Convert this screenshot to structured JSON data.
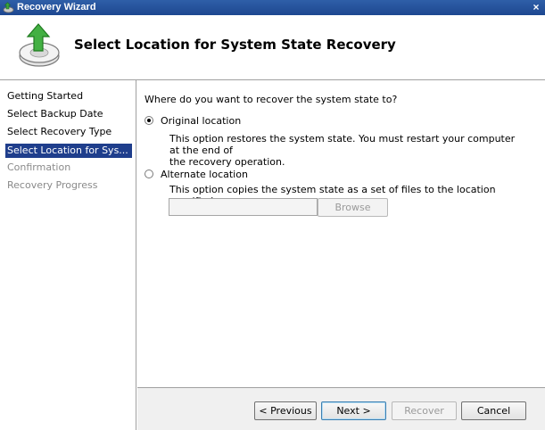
{
  "window": {
    "title": "Recovery Wizard",
    "close_glyph": "×"
  },
  "header": {
    "title": "Select Location for System State Recovery",
    "icon": "recovery-wizard-icon"
  },
  "steps": [
    {
      "label": "Getting Started",
      "state": "done"
    },
    {
      "label": "Select Backup Date",
      "state": "done"
    },
    {
      "label": "Select Recovery Type",
      "state": "done"
    },
    {
      "label": "Select Location for Sys...",
      "state": "active"
    },
    {
      "label": "Confirmation",
      "state": "future"
    },
    {
      "label": "Recovery Progress",
      "state": "future"
    }
  ],
  "content": {
    "question": "Where do you want to recover the system state to?",
    "original": {
      "label": "Original location",
      "checked": true,
      "desc_line1": "This option restores the system state. You must restart your computer at the end of",
      "desc_line2": "the recovery operation."
    },
    "alternate": {
      "label": "Alternate location",
      "checked": false,
      "desc": "This option copies the system state as a set of files to the location specified.",
      "path_value": "",
      "browse_label": "Browse"
    }
  },
  "footer": {
    "previous_label": "< Previous",
    "next_label": "Next >",
    "recover_label": "Recover",
    "cancel_label": "Cancel"
  },
  "colors": {
    "active_step": "#1f3e8c",
    "titlebar": "#1d4790",
    "disabled_text": "#9a9a9a"
  }
}
